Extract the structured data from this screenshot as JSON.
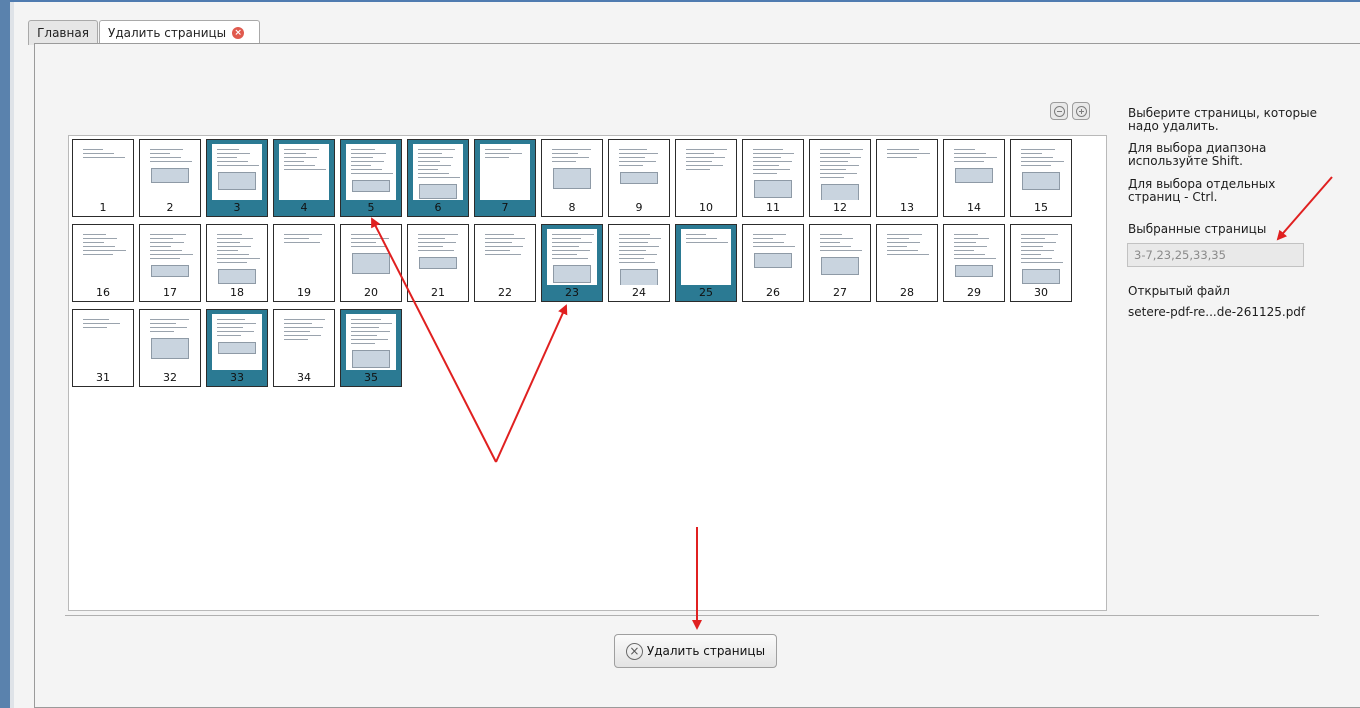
{
  "tabs": {
    "home_label": "Главная",
    "active_label": "Удалить страницы"
  },
  "sidebar": {
    "instruction_1": "Выберите страницы, которые надо удалить.",
    "instruction_2": "Для выбора диапзона используйте Shift.",
    "instruction_3": "Для выбора отдельных страниц - Ctrl.",
    "selected_label": "Выбранные страницы",
    "selected_value": "3-7,23,25,33,35",
    "open_file_label": "Открытый файл",
    "open_file_name": "setere-pdf-re...de-261125.pdf"
  },
  "action": {
    "delete_label": "Удалить страницы"
  },
  "pages": [
    {
      "n": "1",
      "selected": false
    },
    {
      "n": "2",
      "selected": false
    },
    {
      "n": "3",
      "selected": true
    },
    {
      "n": "4",
      "selected": true
    },
    {
      "n": "5",
      "selected": true
    },
    {
      "n": "6",
      "selected": true
    },
    {
      "n": "7",
      "selected": true
    },
    {
      "n": "8",
      "selected": false
    },
    {
      "n": "9",
      "selected": false
    },
    {
      "n": "10",
      "selected": false
    },
    {
      "n": "11",
      "selected": false
    },
    {
      "n": "12",
      "selected": false
    },
    {
      "n": "13",
      "selected": false
    },
    {
      "n": "14",
      "selected": false
    },
    {
      "n": "15",
      "selected": false
    },
    {
      "n": "16",
      "selected": false
    },
    {
      "n": "17",
      "selected": false
    },
    {
      "n": "18",
      "selected": false
    },
    {
      "n": "19",
      "selected": false
    },
    {
      "n": "20",
      "selected": false
    },
    {
      "n": "21",
      "selected": false
    },
    {
      "n": "22",
      "selected": false
    },
    {
      "n": "23",
      "selected": true
    },
    {
      "n": "24",
      "selected": false
    },
    {
      "n": "25",
      "selected": true
    },
    {
      "n": "26",
      "selected": false
    },
    {
      "n": "27",
      "selected": false
    },
    {
      "n": "28",
      "selected": false
    },
    {
      "n": "29",
      "selected": false
    },
    {
      "n": "30",
      "selected": false
    },
    {
      "n": "31",
      "selected": false
    },
    {
      "n": "32",
      "selected": false
    },
    {
      "n": "33",
      "selected": true
    },
    {
      "n": "34",
      "selected": false
    },
    {
      "n": "35",
      "selected": true
    }
  ],
  "colors": {
    "selected_fill": "#2b7a93",
    "annotation_arrow": "#e02020"
  },
  "icons": {
    "tab_close": "close-icon",
    "zoom_out": "zoom-out-icon",
    "zoom_in": "zoom-in-icon",
    "delete": "x-circle-icon"
  }
}
